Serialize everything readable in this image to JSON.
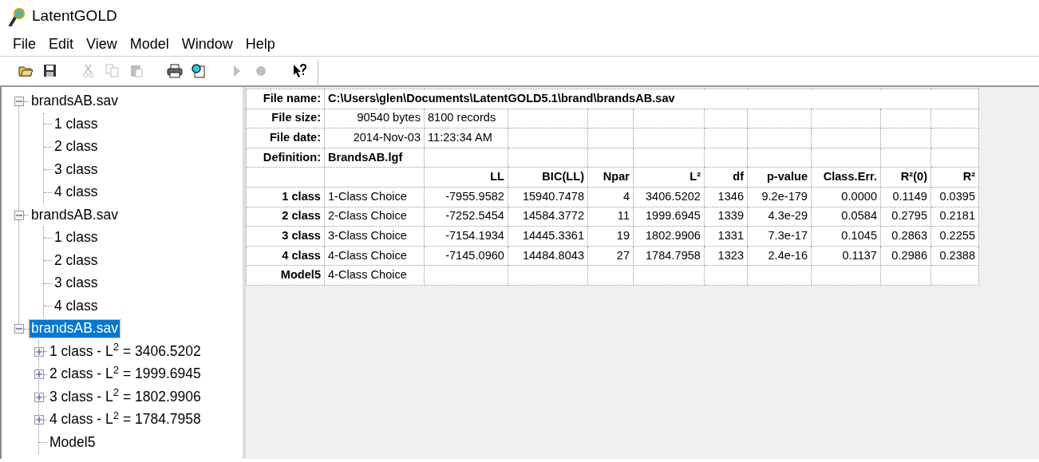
{
  "window": {
    "title": "LatentGOLD"
  },
  "menu": [
    "File",
    "Edit",
    "View",
    "Model",
    "Window",
    "Help"
  ],
  "toolbar": [
    {
      "kind": "open",
      "disabled": false
    },
    {
      "kind": "save",
      "disabled": false
    },
    {
      "kind": "sep"
    },
    {
      "kind": "cut",
      "disabled": true
    },
    {
      "kind": "copy",
      "disabled": true
    },
    {
      "kind": "paste",
      "disabled": true
    },
    {
      "kind": "sep"
    },
    {
      "kind": "print",
      "disabled": false
    },
    {
      "kind": "preview",
      "disabled": false
    },
    {
      "kind": "sep"
    },
    {
      "kind": "run",
      "disabled": true
    },
    {
      "kind": "stop",
      "disabled": true
    },
    {
      "kind": "sep"
    },
    {
      "kind": "help",
      "disabled": false
    }
  ],
  "tree": [
    {
      "label": "brandsAB.sav",
      "expanded": true,
      "selected": false,
      "children": [
        {
          "label": "1 class",
          "expandable": false
        },
        {
          "label": "2 class",
          "expandable": false
        },
        {
          "label": "3 class",
          "expandable": false
        },
        {
          "label": "4 class",
          "expandable": false
        }
      ]
    },
    {
      "label": "brandsAB.sav",
      "expanded": true,
      "selected": false,
      "children": [
        {
          "label": "1 class",
          "expandable": false
        },
        {
          "label": "2 class",
          "expandable": false
        },
        {
          "label": "3 class",
          "expandable": false
        },
        {
          "label": "4 class",
          "expandable": false
        }
      ]
    },
    {
      "label": "brandsAB.sav",
      "expanded": true,
      "selected": true,
      "children": [
        {
          "label": "1 class - L$^{2}$ = 3406.5202",
          "expandable": true
        },
        {
          "label": "2 class - L$^{2}$ = 1999.6945",
          "expandable": true
        },
        {
          "label": "3 class - L$^{2}$ = 1802.9906",
          "expandable": true
        },
        {
          "label": "4 class - L$^{2}$ = 1784.7958",
          "expandable": true
        },
        {
          "label": "Model5",
          "expandable": false
        }
      ]
    }
  ],
  "table": {
    "info": [
      {
        "label": "File name:",
        "values": [
          "C:\\Users\\glen\\Documents\\LatentGOLD5.1\\brand\\brandsAB.sav"
        ],
        "span": true,
        "bold": true
      },
      {
        "label": "File size:",
        "values": [
          "90540 bytes",
          "8100 records"
        ],
        "span": false,
        "bold": false
      },
      {
        "label": "File date:",
        "values": [
          "2014-Nov-03",
          "11:23:34 AM"
        ],
        "span": false,
        "bold": false
      },
      {
        "label": "Definition:",
        "values": [
          "BrandsAB.lgf"
        ],
        "span": false,
        "bold": true
      }
    ],
    "columns": [
      "LL",
      "BIC(LL)",
      "Npar",
      "L²",
      "df",
      "p-value",
      "Class.Err.",
      "R²(0)",
      "R²"
    ],
    "rows": [
      {
        "label": "1 class",
        "name": "1-Class Choice",
        "cells": [
          "-7955.9582",
          "15940.7478",
          "4",
          "3406.5202",
          "1346",
          "9.2e-179",
          "0.0000",
          "0.1149",
          "0.0395"
        ]
      },
      {
        "label": "2 class",
        "name": "2-Class Choice",
        "cells": [
          "-7252.5454",
          "14584.3772",
          "11",
          "1999.6945",
          "1339",
          "4.3e-29",
          "0.0584",
          "0.2795",
          "0.2181"
        ]
      },
      {
        "label": "3 class",
        "name": "3-Class Choice",
        "cells": [
          "-7154.1934",
          "14445.3361",
          "19",
          "1802.9906",
          "1331",
          "7.3e-17",
          "0.1045",
          "0.2863",
          "0.2255"
        ]
      },
      {
        "label": "4 class",
        "name": "4-Class Choice",
        "cells": [
          "-7145.0960",
          "14484.8043",
          "27",
          "1784.7958",
          "1323",
          "2.4e-16",
          "0.1137",
          "0.2986",
          "0.2388"
        ]
      },
      {
        "label": "Model5",
        "name": "4-Class Choice",
        "cells": []
      }
    ]
  }
}
